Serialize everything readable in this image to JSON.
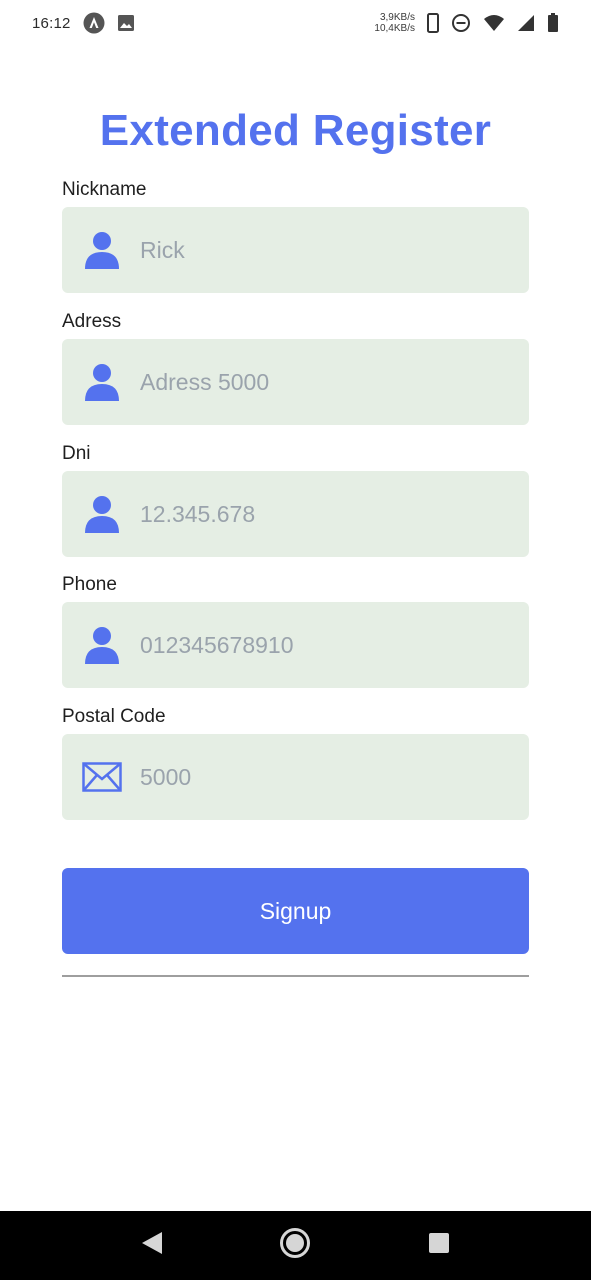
{
  "status_bar": {
    "time": "16:12",
    "net_up": "3,9KB/s",
    "net_down": "10,4KB/s",
    "icons": [
      "app-icon",
      "image-icon",
      "phone-icon",
      "dnd-icon",
      "wifi-icon",
      "signal-icon",
      "battery-icon"
    ]
  },
  "title": "Extended Register",
  "form": {
    "fields": [
      {
        "label": "Nickname",
        "placeholder": "Rick",
        "icon": "user-icon"
      },
      {
        "label": "Adress",
        "placeholder": "Adress 5000",
        "icon": "user-icon"
      },
      {
        "label": "Dni",
        "placeholder": "12.345.678",
        "icon": "user-icon"
      },
      {
        "label": "Phone",
        "placeholder": "012345678910",
        "icon": "user-icon"
      },
      {
        "label": "Postal Code",
        "placeholder": "5000",
        "icon": "envelope-icon"
      }
    ],
    "submit_label": "Signup"
  },
  "colors": {
    "accent": "#5472ee",
    "field_bg": "#e5eee4",
    "placeholder": "#9aa3ac"
  },
  "nav_bar": {
    "buttons": [
      "back-icon",
      "home-icon",
      "recents-icon"
    ]
  }
}
